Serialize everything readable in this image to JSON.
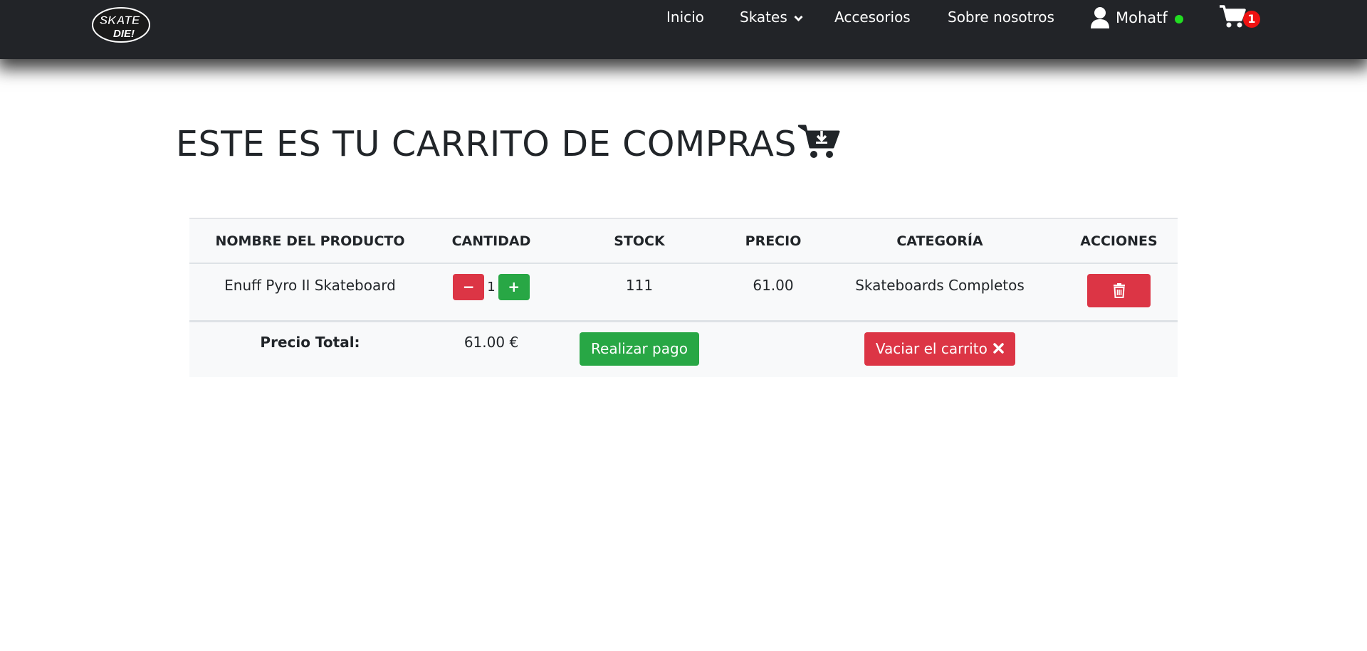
{
  "nav": {
    "logo_text": "SKATE OR DIE!",
    "links": [
      "Inicio",
      "Skates",
      "Accesorios",
      "Sobre nosotros"
    ],
    "user_name": "Mohatf",
    "cart_count": "1"
  },
  "page": {
    "title": "ESTE ES TU CARRITO DE COMPRAS"
  },
  "table": {
    "headers": [
      "NOMBRE DEL PRODUCTO",
      "CANTIDAD",
      "STOCK",
      "PRECIO",
      "CATEGORÍA",
      "ACCIONES"
    ],
    "rows": [
      {
        "name": "Enuff Pyro II Skateboard",
        "quantity": "1",
        "stock": "111",
        "price": "61.00",
        "category": "Skateboards Completos"
      }
    ],
    "qty_minus": "−",
    "qty_plus": "+"
  },
  "footer": {
    "total_label": "Precio Total:",
    "total_value": "61.00 €",
    "pay_label": "Realizar pago",
    "empty_label": "Vaciar el carrito"
  },
  "colors": {
    "navbar": "#222428",
    "danger": "#dc3545",
    "success": "#28a745",
    "online": "#22dd22"
  }
}
